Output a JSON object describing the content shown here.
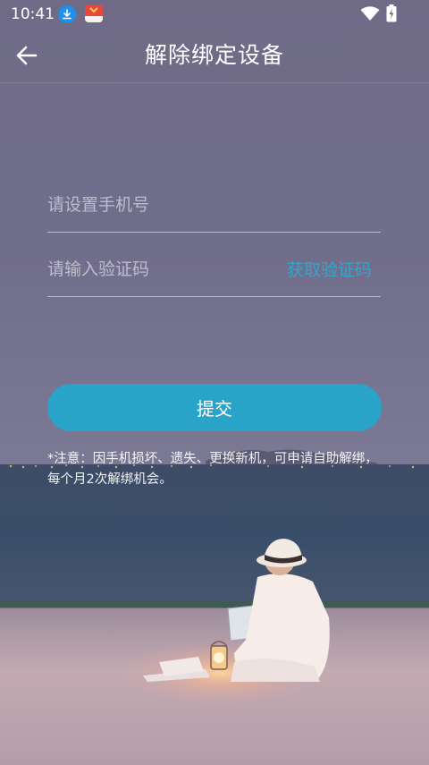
{
  "status_bar": {
    "time": "10:41",
    "icons": [
      "download-icon",
      "app-notification-icon",
      "wifi-icon",
      "battery-charging-icon"
    ]
  },
  "app_bar": {
    "back_icon": "arrow-left-icon",
    "title": "解除绑定设备"
  },
  "form": {
    "phone": {
      "placeholder": "请设置手机号",
      "value": ""
    },
    "code": {
      "placeholder": "请输入验证码",
      "value": ""
    },
    "get_code_label": "获取验证码",
    "submit_label": "提交"
  },
  "notice": {
    "text": "*注意：因手机损坏、遗失、更换新机，可申请自助解绑，每个月2次解绑机会。"
  },
  "colors": {
    "accent": "#29a3c7",
    "link": "#2fa6cc",
    "sky_top": "#6e6a86",
    "sea": "#3c4c66",
    "sand": "#c2a9b1"
  }
}
